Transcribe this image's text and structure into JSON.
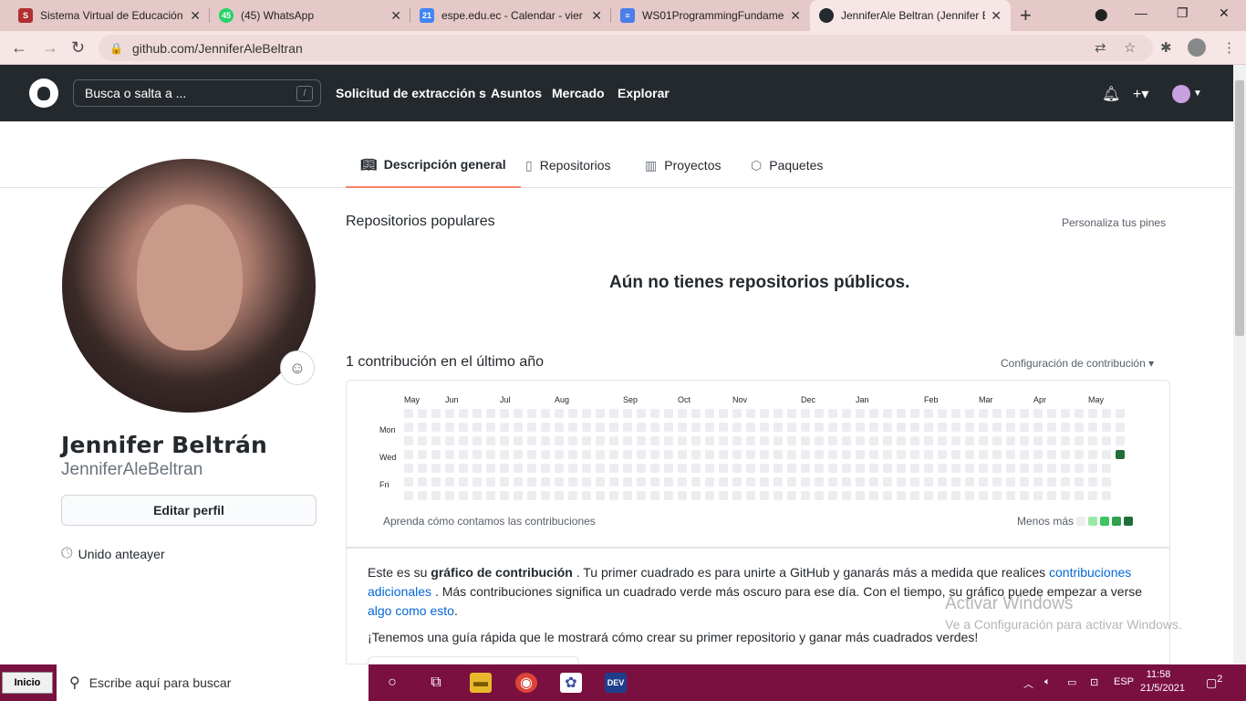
{
  "browser": {
    "tabs": [
      {
        "title": "Sistema Virtual de Educación",
        "favicon": "sve-favicon",
        "color": "#b03030",
        "badge": ""
      },
      {
        "title": "(45) WhatsApp",
        "favicon": "whatsapp-favicon",
        "color": "#25d366",
        "badge": "45"
      },
      {
        "title": "espe.edu.ec - Calendar - vier",
        "favicon": "calendar-favicon",
        "color": "#4285f4",
        "badge": "21"
      },
      {
        "title": "WS01ProgrammingFundame",
        "favicon": "docs-favicon",
        "color": "#4a7ee8",
        "badge": ""
      },
      {
        "title": "JenniferAle Beltran (Jennifer B",
        "favicon": "github-favicon",
        "color": "#24292e",
        "badge": ""
      }
    ],
    "url": "github.com/JenniferAleBeltran"
  },
  "github": {
    "search_placeholder": "Busca o salta a ...",
    "search_shortcut": "/",
    "nav": [
      "Solicitud de extracción s",
      "Asuntos",
      "Mercado",
      "Explorar"
    ]
  },
  "profile_tabs": [
    {
      "label": "Descripción general",
      "icon": "book-icon",
      "glyph": "📖"
    },
    {
      "label": "Repositorios",
      "icon": "repo-icon",
      "glyph": "▯"
    },
    {
      "label": "Proyectos",
      "icon": "project-icon",
      "glyph": "▥"
    },
    {
      "label": "Paquetes",
      "icon": "package-icon",
      "glyph": "⬡"
    }
  ],
  "profile": {
    "full_name": "Jennifer Beltrán",
    "username": "JenniferAleBeltran",
    "edit_button": "Editar perfil",
    "joined": "Unido anteayer"
  },
  "main": {
    "popular_repos": "Repositorios populares",
    "customize_pins": "Personaliza tus pines",
    "no_repos": "Aún no tienes repositorios públicos.",
    "contrib_count": "1 contribución en el último año",
    "contrib_settings": "Configuración de contribución ▾",
    "months": [
      "May",
      "Jun",
      "Jul",
      "Aug",
      "Sep",
      "Oct",
      "Nov",
      "Dec",
      "Jan",
      "Feb",
      "Mar",
      "Apr",
      "May"
    ],
    "days": [
      "Mon",
      "Wed",
      "Fri"
    ],
    "learn_link": "Aprenda cómo contamos las contribuciones",
    "legend_less": "Menos",
    "legend_more": "más",
    "legend_colors": [
      "#ebedf0",
      "#9be9a8",
      "#40c463",
      "#30a14e",
      "#216e39"
    ],
    "contrib_weeks": 53,
    "contrib_highlight": {
      "week": 52,
      "day": 3,
      "color": "#216e39"
    },
    "info_p1_a": "Este es su ",
    "info_p1_b": "gráfico de contribución",
    "info_p1_c": " . Tu primer cuadrado es para unirte a GitHub y ganarás más a medida que realices ",
    "info_p1_link1": "contribuciones adicionales",
    "info_p1_d": " . Más contribuciones significa un cuadrado verde más oscuro para ese día. Con el tiempo, su gráfico puede empezar a verse ",
    "info_p1_link2": "algo como esto",
    "info_p1_e": ".",
    "guide": "¡Tenemos una guía rápida que le mostrará cómo crear su primer repositorio y ganar más cuadrados verdes!"
  },
  "watermark": {
    "line1": "Activar Windows",
    "line2": "Ve a Configuración para activar Windows."
  },
  "taskbar": {
    "start": "Inicio",
    "search": "Escribe aquí para buscar",
    "lang": "ESP",
    "time": "11:58",
    "date": "21/5/2021",
    "notifications": "2"
  }
}
